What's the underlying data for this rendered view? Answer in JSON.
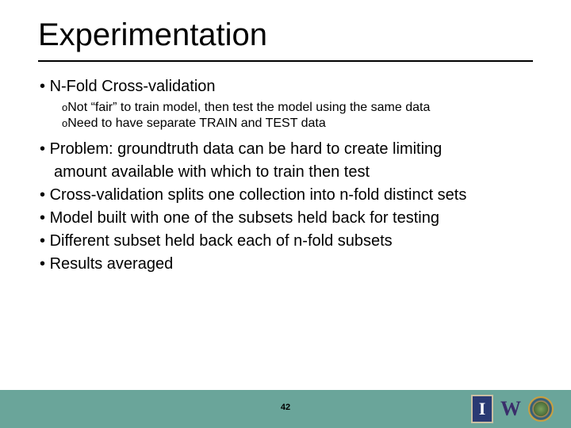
{
  "title": "Experimentation",
  "bullets": {
    "b1": "N-Fold Cross-validation",
    "s1": "Not “fair” to train model, then test the model using the same data",
    "s2": "Need to have separate TRAIN and TEST data",
    "b2a": "Problem: groundtruth data can be hard to create limiting",
    "b2b": "amount available with which to train then test",
    "b3": "Cross-validation splits one collection into n-fold distinct sets",
    "b4": "Model built with one of the subsets held back for testing",
    "b5": "Different subset held back each of n-fold subsets",
    "b6": "Results averaged"
  },
  "page_number": "42",
  "logos": {
    "illinois": "I",
    "washington": "W"
  }
}
